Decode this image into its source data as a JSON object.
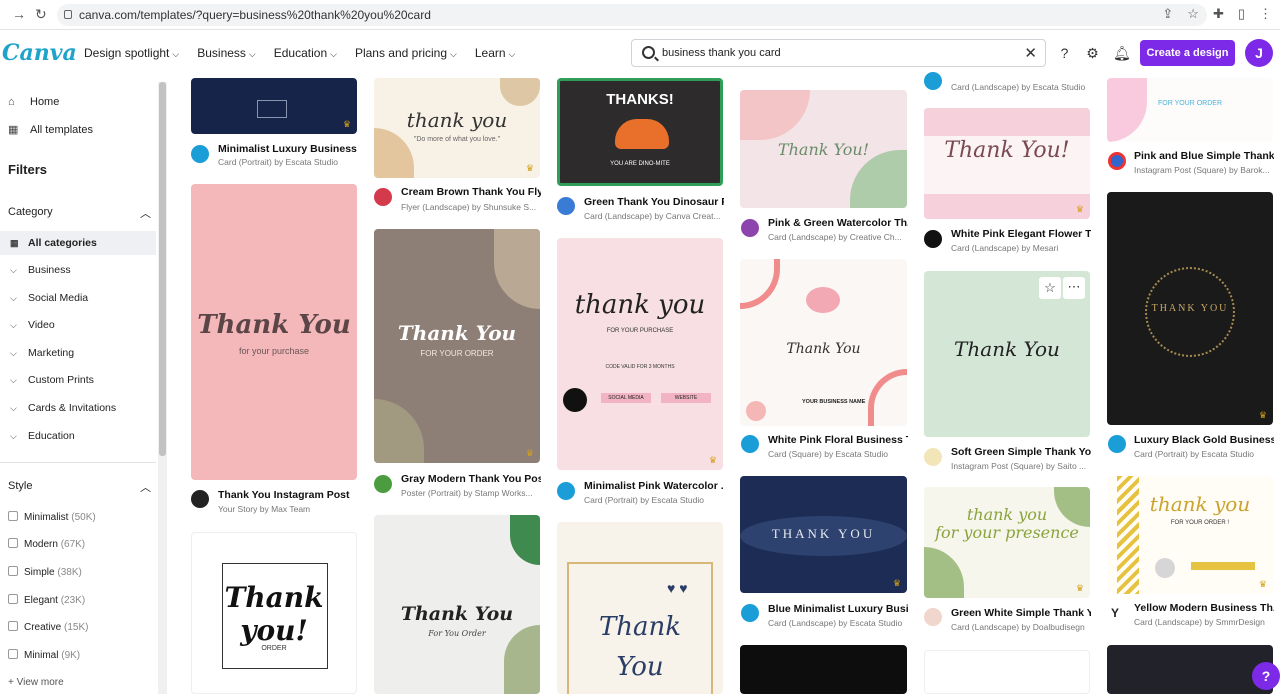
{
  "browser": {
    "url": "canva.com/templates/?query=business%20thank%20you%20card"
  },
  "header": {
    "logo": "Canva",
    "menu": [
      "Design spotlight",
      "Business",
      "Education",
      "Plans and pricing",
      "Learn"
    ],
    "search_value": "business thank you card",
    "create_label": "Create a design",
    "avatar_letter": "J"
  },
  "sidebar": {
    "home": "Home",
    "all_templates": "All templates",
    "filters": "Filters",
    "category_title": "Category",
    "categories": [
      "All categories",
      "Business",
      "Social Media",
      "Video",
      "Marketing",
      "Custom Prints",
      "Cards & Invitations",
      "Education"
    ],
    "style_title": "Style",
    "styles": [
      {
        "name": "Minimalist",
        "count": "(50K)"
      },
      {
        "name": "Modern",
        "count": "(67K)"
      },
      {
        "name": "Simple",
        "count": "(38K)"
      },
      {
        "name": "Elegant",
        "count": "(23K)"
      },
      {
        "name": "Creative",
        "count": "(15K)"
      },
      {
        "name": "Minimal",
        "count": "(9K)"
      }
    ],
    "view_more": "View more"
  },
  "cards": [
    {
      "title": "Minimalist Luxury Business ...",
      "sub": "Card (Portrait) by Escata Studio"
    },
    {
      "title": "Thank You Instagram Post",
      "sub": "Your Story by Max Team",
      "art": "Thank You",
      "art2": "for your purchase"
    },
    {
      "title": "",
      "sub": "",
      "art": "Thank you!",
      "art2": "ORDER"
    },
    {
      "title": "Cream Brown Thank You Fly...",
      "sub": "Flyer (Landscape) by Shunsuke S...",
      "art": "thank you",
      "art2": "\"Do more of what you love.\""
    },
    {
      "title": "Gray Modern Thank You Pos...",
      "sub": "Poster (Portrait) by Stamp Works...",
      "art": "Thank You",
      "art2": "FOR YOUR ORDER"
    },
    {
      "title": "",
      "sub": "",
      "art": "Thank You",
      "art2": "For You Order"
    },
    {
      "title": "Green Thank You Dinosaur F...",
      "sub": "Card (Landscape) by Canva Creat...",
      "art": "THANKS!",
      "art2": "YOU ARE DINO-MITE"
    },
    {
      "title": "Minimalist Pink Watercolor ...",
      "sub": "Card (Portrait) by Escata Studio",
      "art": "thank you",
      "art2": "FOR YOUR PURCHASE",
      "art3": "CODE VALID FOR 3 MONTHS",
      "art4": "SOCIAL MEDIA",
      "art5": "WEBSITE"
    },
    {
      "title": "",
      "sub": "",
      "art": "Thank",
      "art2": "You"
    },
    {
      "title": "Pink & Green Watercolor Th...",
      "sub": "Card (Landscape) by Creative Ch...",
      "art": "Thank You!"
    },
    {
      "title": "White Pink Floral Business T...",
      "sub": "Card (Square) by Escata Studio",
      "art": "Thank You",
      "art2": "YOUR BUSINESS NAME"
    },
    {
      "title": "Blue Minimalist Luxury Busi...",
      "sub": "Card (Landscape) by Escata Studio",
      "art": "THANK YOU"
    },
    {
      "title": "",
      "sub": "Card (Landscape) by Escata Studio"
    },
    {
      "title": "White Pink Elegant Flower T...",
      "sub": "Card (Landscape) by Mesari",
      "art": "Thank You!"
    },
    {
      "title": "Soft Green Simple Thank Yo...",
      "sub": "Instagram Post (Square) by Saito ...",
      "art": "Thank You"
    },
    {
      "title": "Green White Simple Thank Y...",
      "sub": "Card (Landscape) by Doalbudisegn",
      "art": "thank you",
      "art2": "for your presence"
    },
    {
      "title": "Pink and Blue Simple Thank...",
      "sub": "Instagram Post (Square) by Barok...",
      "art2": "FOR YOUR ORDER"
    },
    {
      "title": "Luxury Black Gold Business ...",
      "sub": "Card (Portrait) by Escata Studio",
      "art": "THANK YOU"
    },
    {
      "title": "Yellow Modern Business Th...",
      "sub": "Card (Landscape) by SmmrDesign",
      "art": "thank you",
      "art2": "FOR YOUR ORDER !"
    }
  ],
  "colors": {
    "accent": "#7d2ae8",
    "logo": "#1fa3c9"
  }
}
